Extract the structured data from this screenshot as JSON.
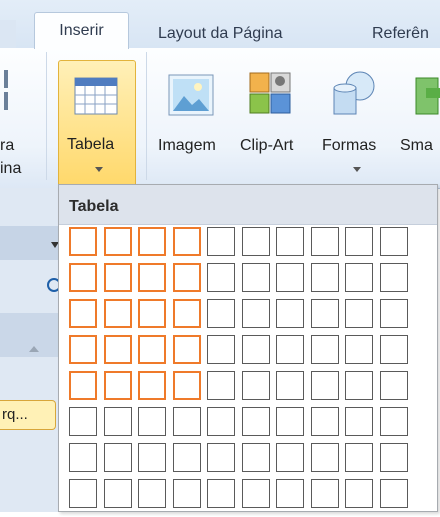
{
  "tabs": [
    {
      "label": "Inserir",
      "active": true
    },
    {
      "label": "Layout da Página",
      "active": false
    },
    {
      "label": "Referên",
      "active": false
    }
  ],
  "ribbon": {
    "left_partial_label_line1": "ra",
    "left_partial_label_line2": "ina",
    "tabela_label": "Tabela",
    "imagem_label": "Imagem",
    "clipart_label": "Clip-Art",
    "formas_label": "Formas",
    "smartart_partial_label": "Sma"
  },
  "left_panel": {
    "partial_button_label": "rq..."
  },
  "table_menu": {
    "header": "Tabela",
    "grid_columns": 10,
    "grid_rows": 8,
    "highlighted_columns": 4,
    "highlighted_rows": 5
  },
  "colors": {
    "highlight": "#ef7a2a",
    "cell_border": "#5a5a5a",
    "ribbon_bg": "#eef4fb"
  }
}
